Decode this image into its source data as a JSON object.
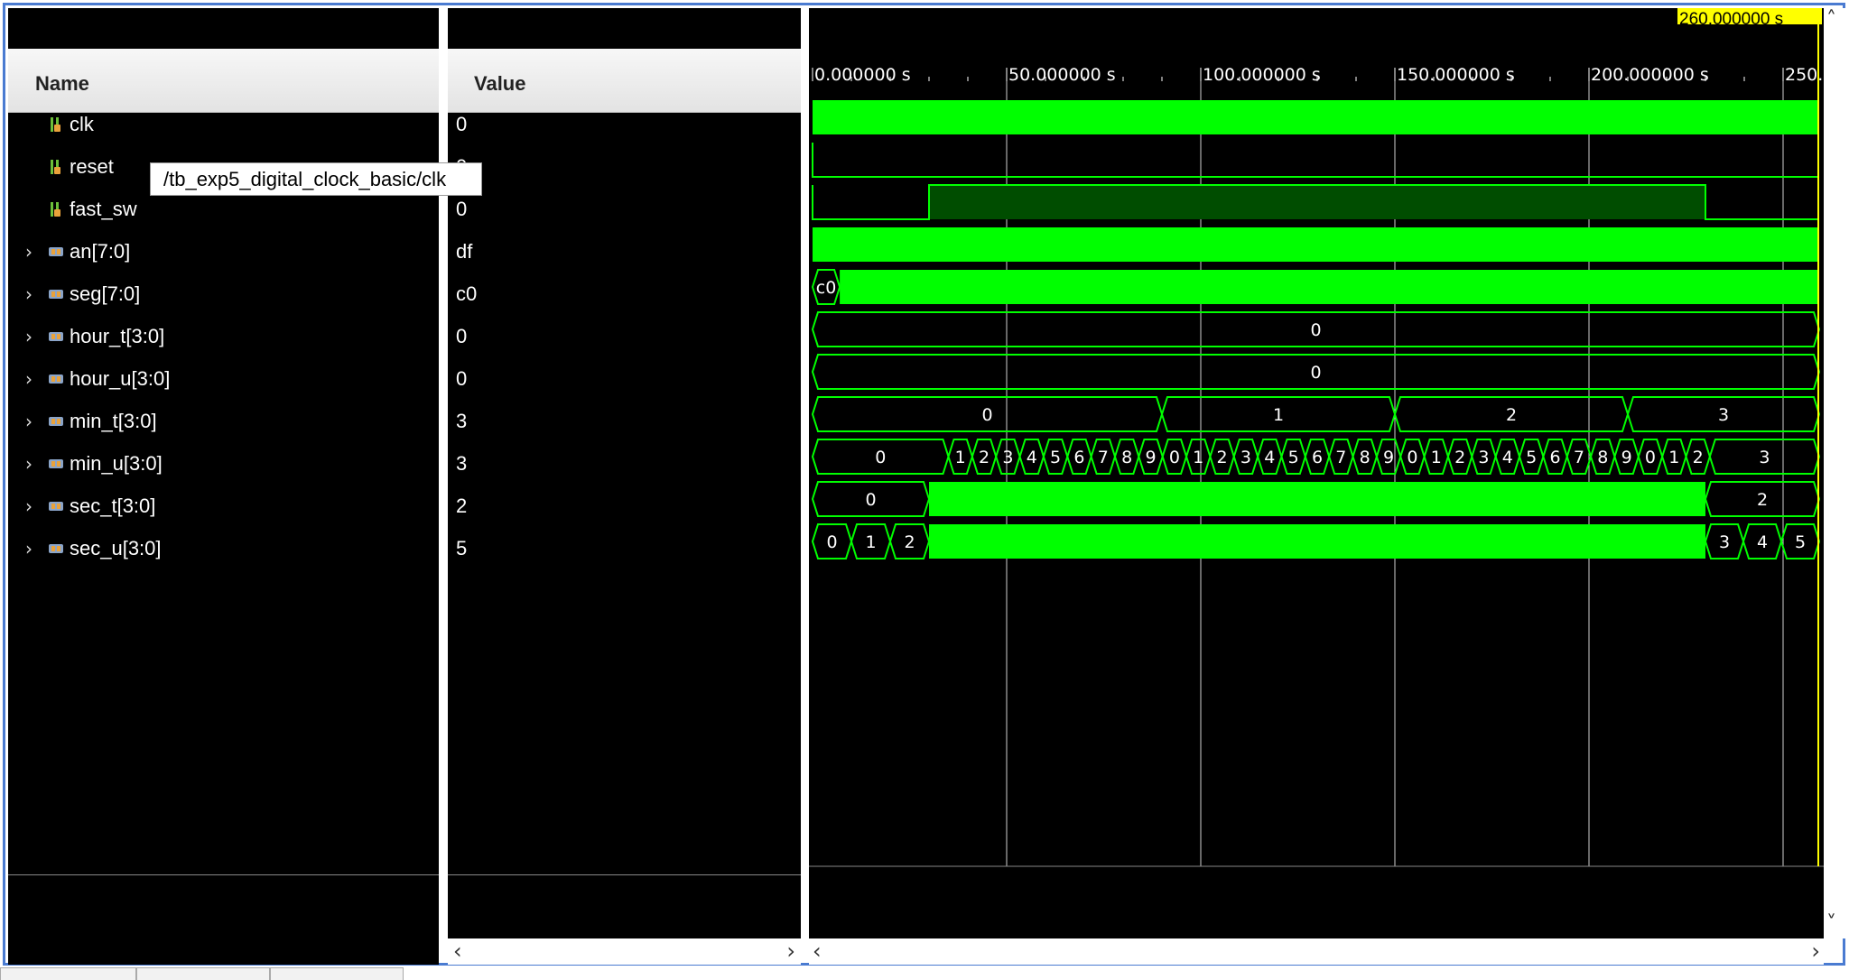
{
  "columns": {
    "name": "Name",
    "value": "Value"
  },
  "tooltip": "/tb_exp5_digital_clock_basic/clk",
  "cursor_time": "260.000000 s",
  "time_ruler": [
    "0.000000 s",
    "50.000000 s",
    "100.000000 s",
    "150.000000 s",
    "200.000000 s",
    "250."
  ],
  "signals": [
    {
      "name": "clk",
      "value": "0",
      "bus": false,
      "icon": "wire-signal-icon"
    },
    {
      "name": "reset",
      "value": "0",
      "bus": false,
      "icon": "wire-signal-icon"
    },
    {
      "name": "fast_sw",
      "value": "0",
      "bus": false,
      "icon": "wire-signal-icon"
    },
    {
      "name": "an[7:0]",
      "value": "df",
      "bus": true,
      "icon": "bus-signal-icon"
    },
    {
      "name": "seg[7:0]",
      "value": "c0",
      "bus": true,
      "icon": "bus-signal-icon"
    },
    {
      "name": "hour_t[3:0]",
      "value": "0",
      "bus": true,
      "icon": "bus-signal-icon"
    },
    {
      "name": "hour_u[3:0]",
      "value": "0",
      "bus": true,
      "icon": "bus-signal-icon"
    },
    {
      "name": "min_t[3:0]",
      "value": "3",
      "bus": true,
      "icon": "bus-signal-icon"
    },
    {
      "name": "min_u[3:0]",
      "value": "3",
      "bus": true,
      "icon": "bus-signal-icon"
    },
    {
      "name": "sec_t[3:0]",
      "value": "2",
      "bus": true,
      "icon": "bus-signal-icon"
    },
    {
      "name": "sec_u[3:0]",
      "value": "5",
      "bus": true,
      "icon": "bus-signal-icon"
    }
  ],
  "wave_labels": {
    "seg": "c0",
    "hour_t": "0",
    "hour_u": "0",
    "min_t": [
      "0",
      "1",
      "2",
      "3"
    ],
    "min_u": [
      "0",
      "1",
      "2",
      "3",
      "4",
      "5",
      "6",
      "7",
      "8",
      "9",
      "0",
      "1",
      "2",
      "3",
      "4",
      "5",
      "6",
      "7",
      "8",
      "9",
      "0",
      "1",
      "2",
      "3",
      "4",
      "5",
      "6",
      "7",
      "8",
      "9",
      "0",
      "1",
      "2",
      "3"
    ],
    "sec_t_start": "0",
    "sec_t_end": "2",
    "sec_u_start": [
      "0",
      "1",
      "2"
    ],
    "sec_u_end": [
      "3",
      "4",
      "5"
    ]
  },
  "colors": {
    "wave": "#00ff00",
    "wave_dark": "#004d00",
    "background": "#000000",
    "cursor": "#ffff00"
  }
}
